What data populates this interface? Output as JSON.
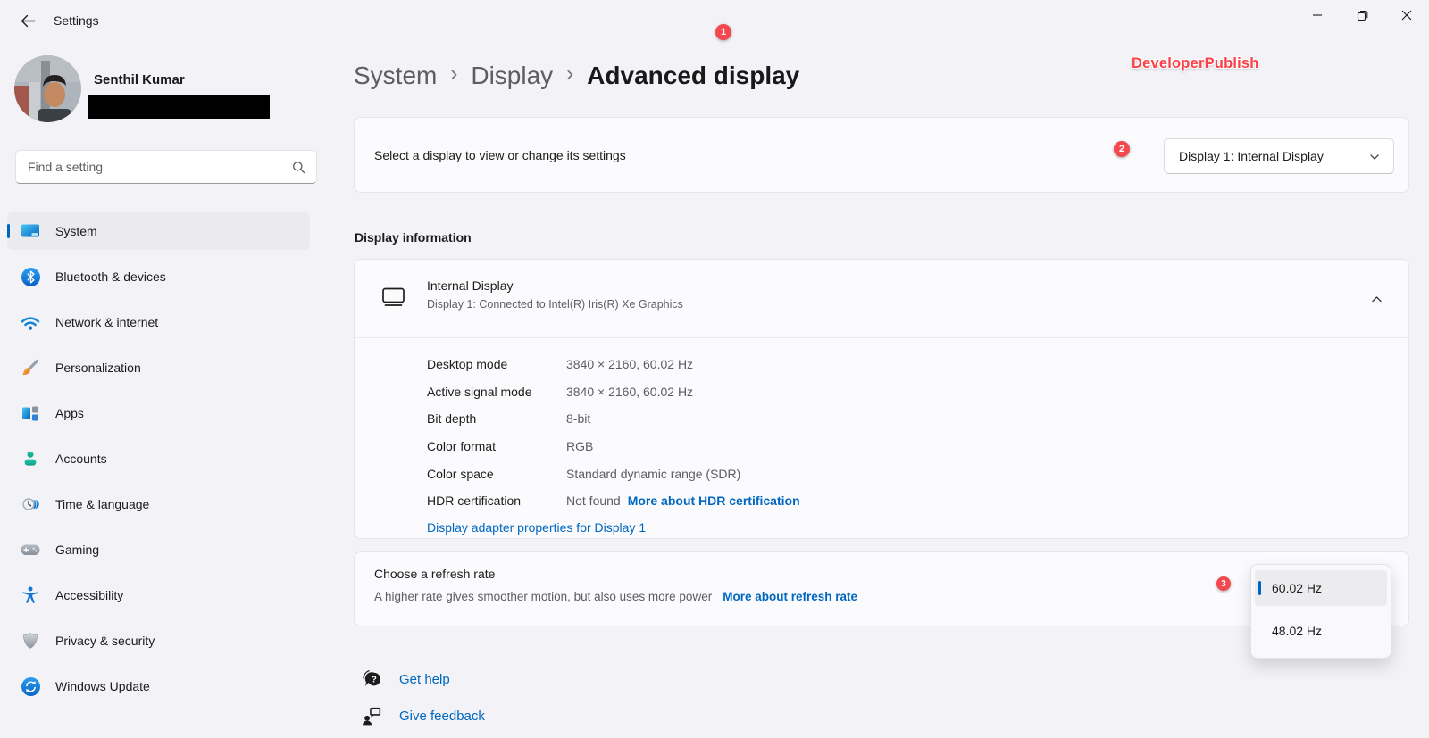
{
  "window": {
    "title": "Settings"
  },
  "user": {
    "name": "Senthil Kumar"
  },
  "search": {
    "placeholder": "Find a setting"
  },
  "sidebar": {
    "items": [
      {
        "label": "System",
        "icon": "system-icon",
        "selected": true
      },
      {
        "label": "Bluetooth & devices",
        "icon": "bluetooth-icon",
        "selected": false
      },
      {
        "label": "Network & internet",
        "icon": "network-icon",
        "selected": false
      },
      {
        "label": "Personalization",
        "icon": "personalization-icon",
        "selected": false
      },
      {
        "label": "Apps",
        "icon": "apps-icon",
        "selected": false
      },
      {
        "label": "Accounts",
        "icon": "accounts-icon",
        "selected": false
      },
      {
        "label": "Time & language",
        "icon": "time-language-icon",
        "selected": false
      },
      {
        "label": "Gaming",
        "icon": "gaming-icon",
        "selected": false
      },
      {
        "label": "Accessibility",
        "icon": "accessibility-icon",
        "selected": false
      },
      {
        "label": "Privacy & security",
        "icon": "privacy-icon",
        "selected": false
      },
      {
        "label": "Windows Update",
        "icon": "windows-update-icon",
        "selected": false
      }
    ]
  },
  "header": {
    "breadcrumb": {
      "items": [
        "System",
        "Display",
        "Advanced display"
      ],
      "separator": "›"
    },
    "watermark": "DeveloperPublish"
  },
  "badges": {
    "one": "1",
    "two": "2",
    "three": "3"
  },
  "main": {
    "select_display": {
      "label": "Select a display to view or change its settings",
      "dropdown_value": "Display 1: Internal Display"
    },
    "display_information": {
      "section_title": "Display information",
      "card_title": "Internal Display",
      "card_subtitle": "Display 1: Connected to Intel(R) Iris(R) Xe Graphics",
      "rows": [
        {
          "label": "Desktop mode",
          "value": "3840 × 2160, 60.02 Hz"
        },
        {
          "label": "Active signal mode",
          "value": "3840 × 2160, 60.02 Hz"
        },
        {
          "label": "Bit depth",
          "value": "8-bit"
        },
        {
          "label": "Color format",
          "value": "RGB"
        },
        {
          "label": "Color space",
          "value": "Standard dynamic range (SDR)"
        },
        {
          "label": "HDR certification",
          "value": "Not found",
          "link": "More about HDR certification"
        }
      ],
      "adapter_link": "Display adapter properties for Display 1"
    },
    "refresh_rate": {
      "title": "Choose a refresh rate",
      "subtitle": "A higher rate gives smoother motion, but also uses more power",
      "link": "More about refresh rate",
      "options": [
        {
          "label": "60.02 Hz",
          "selected": true
        },
        {
          "label": "48.02 Hz",
          "selected": false
        }
      ]
    },
    "footer": {
      "get_help": "Get help",
      "give_feedback": "Give feedback"
    }
  },
  "colors": {
    "accent": "#0067C0",
    "link": "#0067C0",
    "badge_red": "#F3484D",
    "watermark_red": "#FB4048",
    "background": "#F2F2F7",
    "card": "#FBFBFD"
  }
}
